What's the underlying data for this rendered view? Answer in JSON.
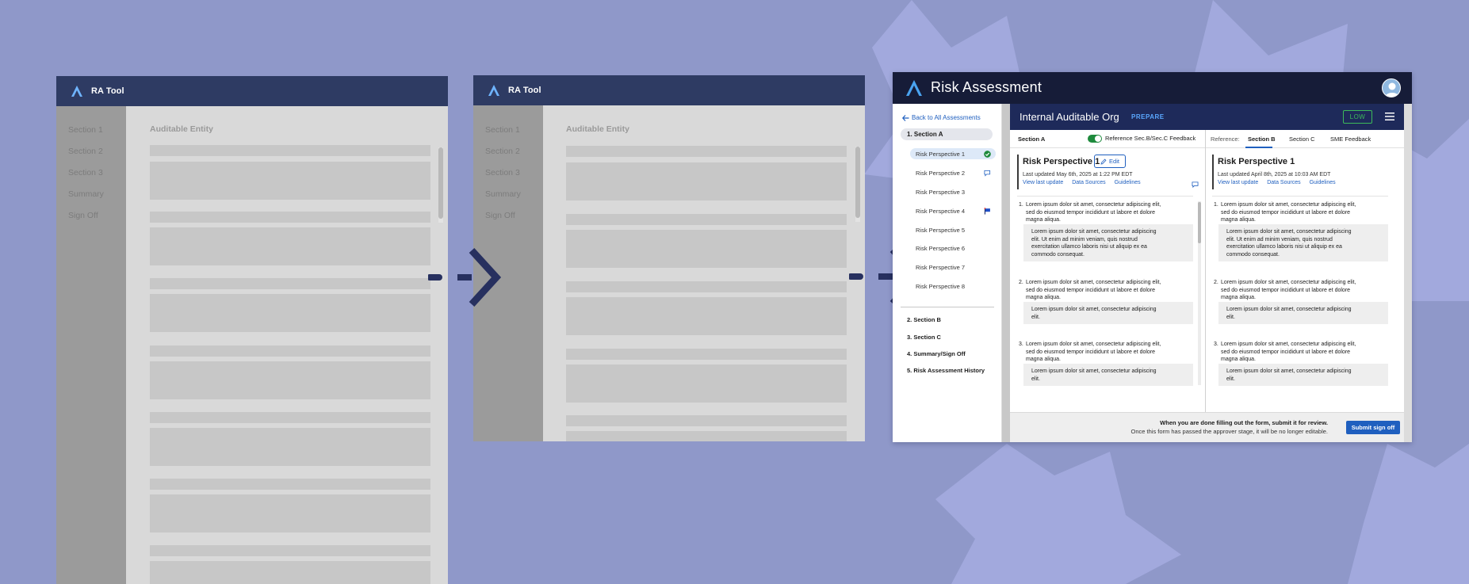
{
  "wireframe": {
    "title": "RA Tool",
    "nav": [
      "Section 1",
      "Section 2",
      "Section 3",
      "Summary",
      "Sign Off"
    ],
    "content_title": "Auditable Entity"
  },
  "app": {
    "title": "Risk Assessment",
    "back_link": "Back to All Assessments",
    "org_name": "Internal Auditable Org",
    "org_status": "PREPARE",
    "risk_badge": "LOW",
    "sidebar": {
      "section_a": "1. Section A",
      "risk_perspectives": [
        {
          "label": "Risk Perspective 1",
          "icon": "check-circle-icon"
        },
        {
          "label": "Risk Perspective 2",
          "icon": "comment-icon"
        },
        {
          "label": "Risk Perspective 3",
          "icon": ""
        },
        {
          "label": "Risk Perspective 4",
          "icon": "flag-icon"
        },
        {
          "label": "Risk Perspective 5",
          "icon": ""
        },
        {
          "label": "Risk Perspective 6",
          "icon": ""
        },
        {
          "label": "Risk Perspective 7",
          "icon": ""
        },
        {
          "label": "Risk Perspective 8",
          "icon": ""
        }
      ],
      "sections": [
        "2. Section  B",
        "3. Section C",
        "4. Summary/Sign Off",
        "5. Risk Assessment History"
      ]
    },
    "tabbar": {
      "section": "Section A",
      "toggle_label": "Reference Sec.B/Sec.C Feedback",
      "reference_label": "Reference:",
      "tabs": [
        "Section B",
        "Section C",
        "SME Feedback"
      ]
    },
    "left_card": {
      "title": "Risk Perspective 1",
      "edit_label": "Edit",
      "updated": "Last updated May 6th, 2025 at 1:22 PM EDT",
      "links": [
        "View last update",
        "Data Sources",
        "Guidelines"
      ]
    },
    "right_card": {
      "title": "Risk Perspective 1",
      "updated": "Last updated April 8th, 2025 at 10:03 AM EDT",
      "links": [
        "View last update",
        "Data Sources",
        "Guidelines"
      ]
    },
    "questions": [
      {
        "num": "1.",
        "lines": [
          "Lorem ipsum dolor sit amet, consectetur adipiscing elit,",
          "sed do eiusmod tempor incididunt ut labore et dolore",
          "magna aliqua."
        ],
        "answer": [
          "Lorem ipsum dolor sit amet, consectetur adipiscing",
          "elit. Ut enim ad minim veniam, quis nostrud",
          "exercitation ullamco laboris nisi ut aliquip ex ea",
          "commodo consequat."
        ]
      },
      {
        "num": "2.",
        "lines": [
          "Lorem ipsum dolor sit amet, consectetur adipiscing elit,",
          "sed do eiusmod tempor incididunt ut labore et dolore",
          "magna aliqua."
        ],
        "answer": [
          "Lorem ipsum dolor sit amet, consectetur adipiscing",
          "elit."
        ]
      },
      {
        "num": "3.",
        "lines": [
          "Lorem ipsum dolor sit amet, consectetur adipiscing elit,",
          "sed do eiusmod tempor incididunt ut labore et dolore",
          "magna aliqua."
        ],
        "answer": [
          "Lorem ipsum dolor sit amet, consectetur adipiscing",
          "elit."
        ]
      }
    ],
    "footer": {
      "line1": "When you are done filling out the form, submit it for review.",
      "line2": "Once this form has passed the approver stage, it will be no longer editable.",
      "submit_label": "Submit sign off"
    }
  },
  "colors": {
    "background": "#8f98c9",
    "header_dark": "#161c38",
    "org_bar": "#1e2a5a",
    "wire_header": "#2e3b63",
    "accent_blue": "#1f5fbf",
    "success_green": "#1e8a3c",
    "arrow": "#27305f"
  }
}
